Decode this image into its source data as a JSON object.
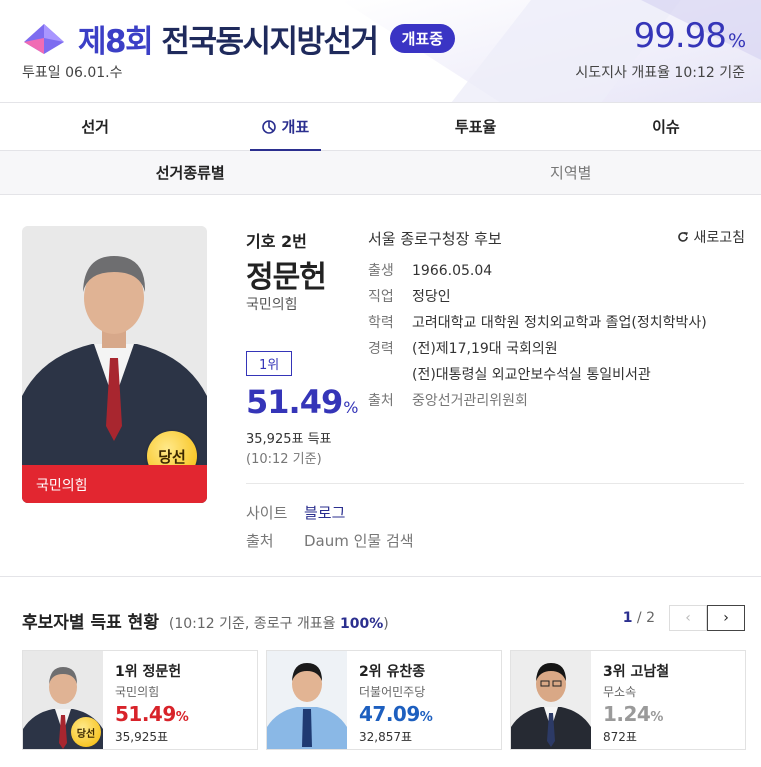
{
  "header": {
    "title_num": "제8회",
    "title_text": "전국동시지방선거",
    "live_badge": "개표중",
    "vote_date": "투표일 06.01.수",
    "count_rate": "99.98",
    "count_rate_unit": "%",
    "count_note": "시도지사 개표율 10:12 기준",
    "accent": "#3a34c4"
  },
  "tabs": [
    {
      "label": "선거"
    },
    {
      "label": "개표",
      "icon": "pie-chart-icon"
    },
    {
      "label": "투표율"
    },
    {
      "label": "이슈"
    }
  ],
  "subtabs": [
    {
      "label": "선거종류별"
    },
    {
      "label": "지역별"
    }
  ],
  "candidate": {
    "number": "기호 2번",
    "name": "정문헌",
    "party": "국민의힘",
    "rank": "1위",
    "percent": "51.49",
    "percent_unit": "%",
    "votes": "35,925표 득표",
    "time": "(10:12 기준)",
    "photo_party": "국민의힘",
    "win_label": "당선",
    "party_color": "#e22630",
    "info_title": "서울 종로구청장 후보",
    "refresh": "새로고침",
    "info": [
      {
        "key": "출생",
        "value": "1966.05.04"
      },
      {
        "key": "직업",
        "value": "정당인"
      },
      {
        "key": "학력",
        "value": "고려대학교 대학원 정치외교학과 졸업(정치학박사)"
      },
      {
        "key": "경력",
        "value": "(전)제17,19대 국회의원"
      },
      {
        "key": "",
        "value": "(전)대통령실 외교안보수석실 통일비서관"
      },
      {
        "key": "출처",
        "value": "중앙선거관리위원회"
      }
    ],
    "site_key": "사이트",
    "site_value": "블로그",
    "source_key": "출처",
    "source_value": "Daum 인물 검색"
  },
  "results": {
    "title": "후보자별 득표 현황",
    "note_prefix": "(10:12 기준, 종로구 개표율",
    "note_rate": "100%",
    "note_suffix": ")",
    "page_current": "1",
    "page_total": "/ 2",
    "cards": [
      {
        "rank": "1위",
        "name": "정문헌",
        "party": "국민의힘",
        "percent": "51.49",
        "unit": "%",
        "votes": "35,925표",
        "color": "#d8232a",
        "win": "당선"
      },
      {
        "rank": "2위",
        "name": "유찬종",
        "party": "더불어민주당",
        "percent": "47.09",
        "unit": "%",
        "votes": "32,857표",
        "color": "#1d5fbf"
      },
      {
        "rank": "3위",
        "name": "고남철",
        "party": "무소속",
        "percent": "1.24",
        "unit": "%",
        "votes": "872표",
        "color": "#9a9a9a"
      }
    ]
  }
}
